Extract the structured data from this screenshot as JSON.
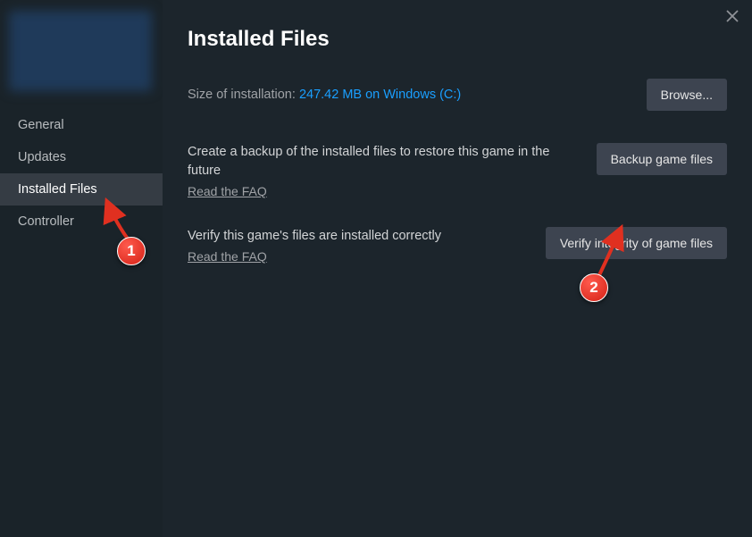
{
  "sidebar": {
    "items": [
      {
        "label": "General"
      },
      {
        "label": "Updates"
      },
      {
        "label": "Installed Files"
      },
      {
        "label": "Controller"
      }
    ],
    "active_index": 2
  },
  "page": {
    "title": "Installed Files",
    "size_label": "Size of installation: ",
    "size_value": "247.42 MB on Windows (C:)",
    "browse_button": "Browse...",
    "backup": {
      "title": "Create a backup of the installed files to restore this game in the future",
      "link": "Read the FAQ",
      "button": "Backup game files"
    },
    "verify": {
      "title": "Verify this game's files are installed correctly",
      "link": "Read the FAQ",
      "button": "Verify integrity of game files"
    }
  },
  "annotations": {
    "badge1": "1",
    "badge2": "2"
  }
}
